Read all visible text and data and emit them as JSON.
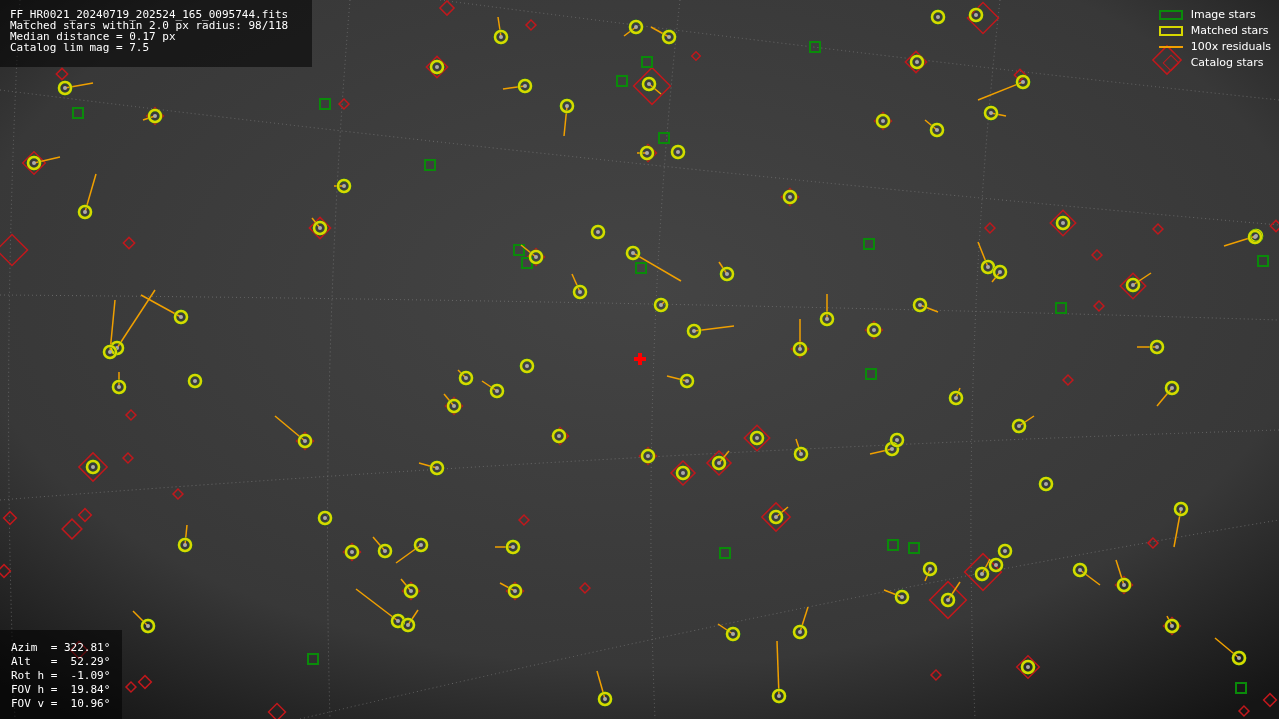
{
  "info": [
    "FF_HR0021_20240719_202524_165_0095744.fits",
    "Matched stars within 2.0 px radius: 98/118",
    "Median distance = 0.17 px",
    "Catalog lim mag = 7.5"
  ],
  "pointing": [
    "Azim  = 322.81°",
    "Alt   =  52.29°",
    "Rot h =  -1.09°",
    "FOV h =  19.84°",
    "FOV v =  10.96°"
  ],
  "legend": [
    {
      "kind": "image",
      "label": "Image stars"
    },
    {
      "kind": "matched",
      "label": "Matched stars"
    },
    {
      "kind": "residual",
      "label": "100x residuals"
    },
    {
      "kind": "catalog",
      "label": "Catalog stars"
    }
  ]
}
